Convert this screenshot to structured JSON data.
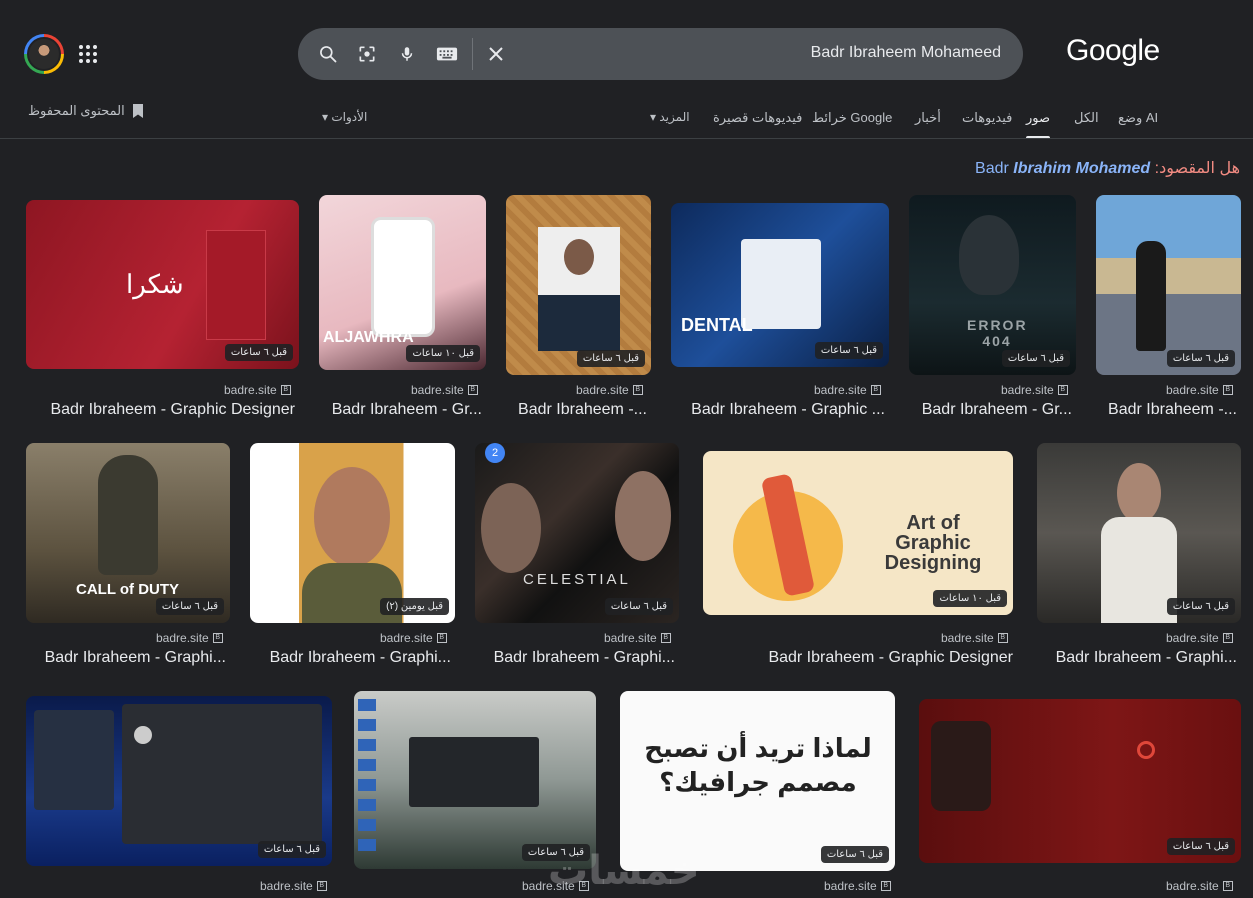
{
  "header": {
    "search_query": "Badr Ibraheem Mohameed",
    "logo_text": "Google",
    "saved_label": "المحتوى المحفوظ"
  },
  "tabs": [
    {
      "label": "وضع AI"
    },
    {
      "label": "الكل"
    },
    {
      "label": "صور"
    },
    {
      "label": "فيديوهات"
    },
    {
      "label": "أخبار"
    },
    {
      "label": "خرائط Google"
    },
    {
      "label": "فيديوهات قصيرة"
    },
    {
      "label": "المزيد"
    }
  ],
  "tools_label": "الأدوات",
  "did_you_mean": {
    "label": "هل المقصود:",
    "prefix": "Badr",
    "emphasis": "Ibrahim Mohamed"
  },
  "results": [
    {
      "badge": "قبل ٦ ساعات",
      "source": "badre.site",
      "title": "Badr Ibraheem - Graphic Designer"
    },
    {
      "badge": "قبل ١٠ ساعات",
      "source": "badre.site",
      "title": "Badr Ibraheem - Gr..."
    },
    {
      "badge": "قبل ٦ ساعات",
      "source": "badre.site",
      "title": "Badr Ibraheem -..."
    },
    {
      "badge": "قبل ٦ ساعات",
      "source": "badre.site",
      "title": "Badr Ibraheem - Graphic ..."
    },
    {
      "badge": "قبل ٦ ساعات",
      "source": "badre.site",
      "title": "Badr Ibraheem - Gr..."
    },
    {
      "badge": "قبل ٦ ساعات",
      "source": "badre.site",
      "title": "Badr Ibraheem -..."
    },
    {
      "badge": "قبل ٦ ساعات",
      "source": "badre.site",
      "title": "Badr Ibraheem - Graphi..."
    },
    {
      "badge": "قبل يومين (٢)",
      "source": "badre.site",
      "title": "Badr Ibraheem - Graphi..."
    },
    {
      "badge": "قبل ٦ ساعات",
      "source": "badre.site",
      "title": "Badr Ibraheem - Graphi..."
    },
    {
      "badge": "قبل ١٠ ساعات",
      "source": "badre.site",
      "title": "Badr Ibraheem - Graphic Designer"
    },
    {
      "badge": "قبل ٦ ساعات",
      "source": "badre.site",
      "title": "Badr Ibraheem - Graphi..."
    },
    {
      "badge": "قبل ٦ ساعات",
      "source": "badre.site",
      "title": ""
    },
    {
      "badge": "قبل ٦ ساعات",
      "source": "badre.site",
      "title": ""
    },
    {
      "badge": "قبل ٦ ساعات",
      "source": "badre.site",
      "title": ""
    },
    {
      "badge": "قبل ٦ ساعات",
      "source": "badre.site",
      "title": ""
    }
  ],
  "image_texts": {
    "r2_headline": "Art of Graphic Designing",
    "r3_headline": "لماذا تريد أن تصبح مصمم جرافيك؟",
    "poster_dental": "DENTAL",
    "poster_error": "ERROR 404",
    "poster_celestial": "CELESTIAL",
    "poster_cod": "CALL of DUTY"
  },
  "watermark": "خمسات",
  "colors": {
    "background": "#202124",
    "search_bg": "#4d5156",
    "link": "#8ab4f8",
    "suggest_label": "#f28b82"
  }
}
